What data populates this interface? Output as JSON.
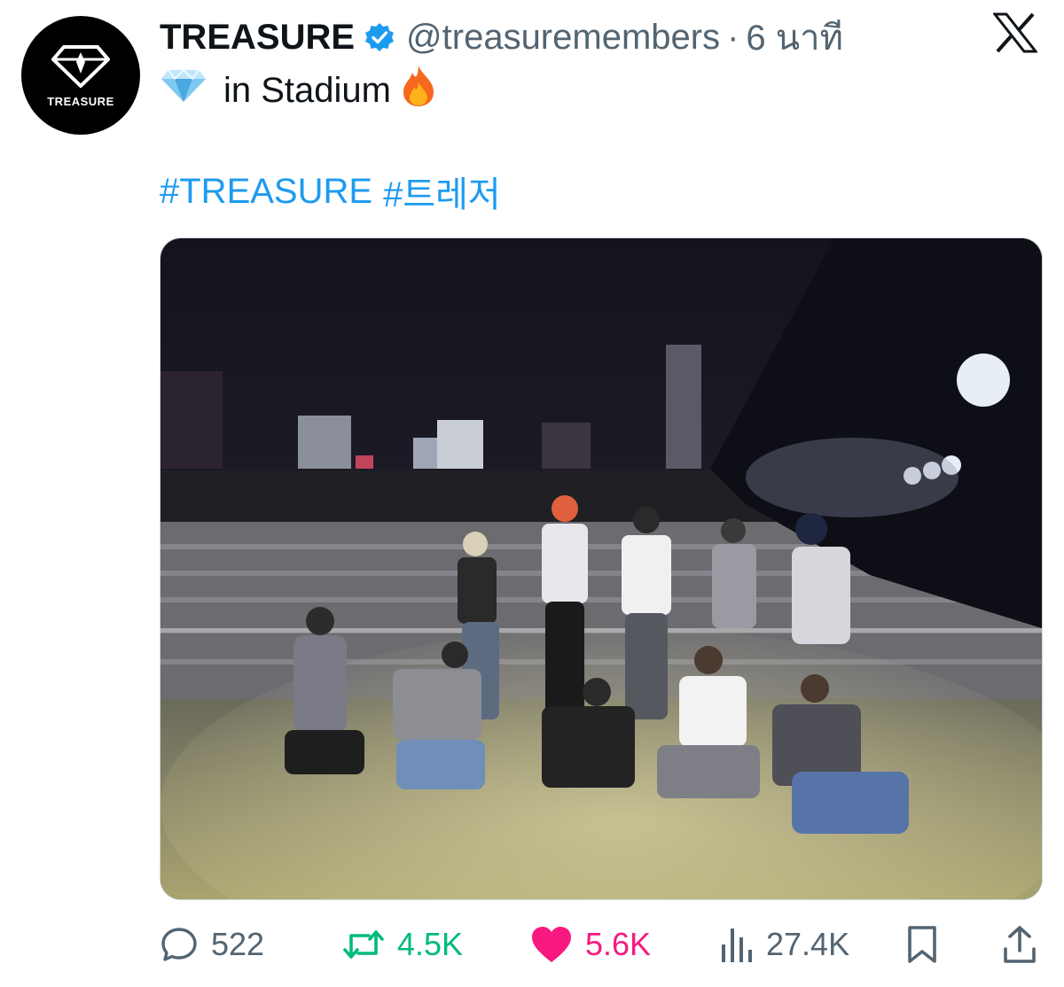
{
  "account": {
    "name": "TREASURE",
    "handle": "@treasuremembers",
    "time_separator": "·",
    "time_ago": "6 นาที",
    "avatar_wordmark": "TREASURE"
  },
  "tweet": {
    "line1_prefix_emoji": "💎",
    "line1_text": "in Stadium",
    "line1_suffix_emoji": "🔥",
    "hashtags": [
      "#TREASURE",
      "#트레저"
    ]
  },
  "stats": {
    "replies": "522",
    "retweets": "4.5K",
    "likes": "5.6K",
    "views": "27.4K"
  },
  "colors": {
    "link": "#1d9bf0",
    "retweet": "#00ba7c",
    "like": "#f91880",
    "muted": "#536471",
    "verified": "#1d9bf0"
  },
  "icons": [
    "treasure-logo-icon",
    "verified-badge-icon",
    "x-logo-icon",
    "gem-emoji-icon",
    "fire-emoji-icon",
    "reply-icon",
    "retweet-icon",
    "like-icon",
    "views-icon",
    "bookmark-icon",
    "share-icon"
  ]
}
